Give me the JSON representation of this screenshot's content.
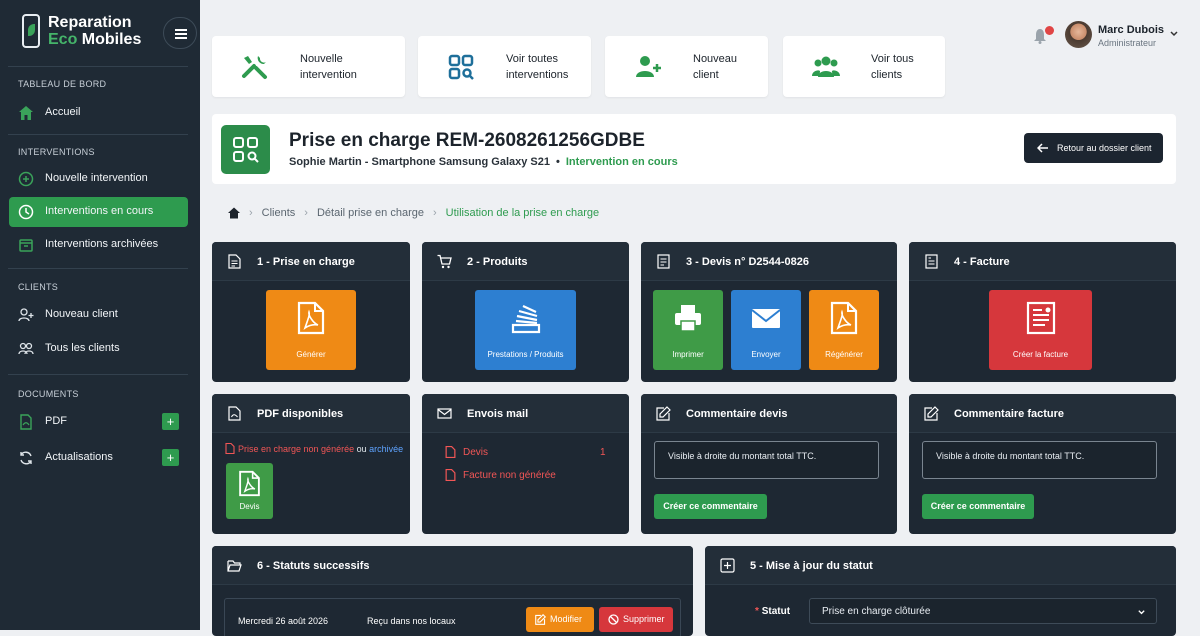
{
  "brand": {
    "line1": "Reparation",
    "line2": "Eco Mobiles"
  },
  "sidebar": {
    "sections": [
      {
        "label": "TABLEAU DE BORD"
      },
      {
        "label": "INTERVENTIONS"
      },
      {
        "label": "CLIENTS"
      },
      {
        "label": "DOCUMENTS"
      }
    ],
    "items": [
      {
        "label": "Accueil"
      },
      {
        "label": "Nouvelle intervention"
      },
      {
        "label": "Interventions en cours"
      },
      {
        "label": "Interventions archivées"
      },
      {
        "label": "Nouveau client"
      },
      {
        "label": "Tous les clients"
      },
      {
        "label": "PDF",
        "badge": "+"
      },
      {
        "label": "Actualisations",
        "badge": "+"
      }
    ]
  },
  "quick_actions": [
    {
      "label": "Nouvelle\nintervention",
      "icon": "tools-icon"
    },
    {
      "label": "Voir toutes\ninterventions",
      "icon": "qr-icon"
    },
    {
      "label": "Nouveau\nclient",
      "icon": "add-user-icon"
    },
    {
      "label": "Voir tous\nclients",
      "icon": "users-icon"
    }
  ],
  "user": {
    "name": "Marc Dubois",
    "role": "Administrateur",
    "notifications": "1"
  },
  "header": {
    "title": "Prise en charge REM-2608261256GDBE",
    "client": "Sophie Martin - Smartphone Samsung Galaxy S21",
    "dot": "•",
    "status": "Intervention en cours",
    "back_label": "Retour au dossier client"
  },
  "breadcrumb": {
    "items": [
      "Clients",
      "Détail prise en charge",
      "Utilisation de la prise en charge"
    ],
    "sep": "›"
  },
  "panels": {
    "p1": {
      "title": "1 - Prise en charge",
      "tile": "Générer"
    },
    "p2": {
      "title": "2 - Produits",
      "tile": "Prestations / Produits"
    },
    "p3": {
      "title": "3 - Devis n° D2544-0826",
      "tiles": [
        "Imprimer",
        "Envoyer",
        "Régénérer"
      ]
    },
    "p4": {
      "title": "4 - Facture",
      "tile": "Créer la facture"
    },
    "pdf": {
      "title": "PDF disponibles",
      "note_red": "Prise en charge non générée",
      "note_mid": " ou ",
      "note_blue": "archivée",
      "tile": "Devis"
    },
    "mail": {
      "title": "Envois mail",
      "rows": [
        {
          "label": "Devis",
          "count": "1"
        },
        {
          "label": "Facture non générée",
          "count": ""
        }
      ]
    },
    "cdevis": {
      "title": "Commentaire devis",
      "text": "Visible à droite du montant total TTC.",
      "button": "Créer ce commentaire"
    },
    "cfact": {
      "title": "Commentaire facture",
      "text": "Visible à droite du montant total TTC.",
      "button": "Créer ce commentaire"
    },
    "statuts": {
      "title": "6 - Statuts successifs",
      "row": {
        "date": "Mercredi 26 août 2026",
        "label": "Reçu dans nos locaux",
        "edit": "Modifier",
        "delete": "Supprimer"
      }
    },
    "maj": {
      "title": "5 - Mise à jour du statut",
      "required": "*",
      "field_label": "Statut",
      "value": "Prise en charge clôturée"
    }
  },
  "colors": {
    "accent": "#2e9b4f",
    "sidebar": "#1f2a35",
    "panel": "#1e2833",
    "orange": "#ef8a15",
    "blue": "#2d7fd1",
    "red": "#d6373c"
  }
}
